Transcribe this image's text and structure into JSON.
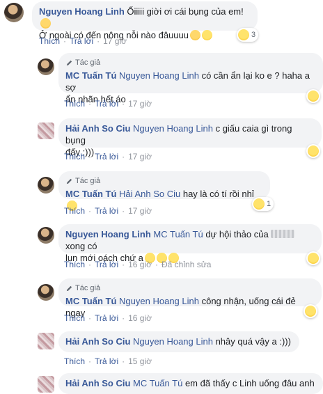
{
  "actions": {
    "like": "Thích",
    "reply": "Trả lời",
    "edited": "Đã chỉnh sửa"
  },
  "comments": [
    {
      "author": "Nguyen Hoang Linh",
      "line1": "Ốiiiii giời ơi cái bụng của em!",
      "line2": "Ở ngoài có đến nông nỗi nào đâuuuu",
      "time": "17 giờ",
      "reaction_count": "3"
    },
    {
      "badge": "Tác giả",
      "author": "MC Tuấn Tú",
      "tag": "Nguyen Hoang Linh",
      "line1": "có cần ẩn lại ko e ? haha a sợ",
      "line2": "ẩn nhãn hết áo",
      "time": "17 giờ"
    },
    {
      "author": "Hải Anh So Ciu",
      "tag": "Nguyen Hoang Linh",
      "line1": "c giấu caia gì trong bụng",
      "line2": "đấy :)))",
      "time": "17 giờ"
    },
    {
      "badge": "Tác giả",
      "author": "MC Tuấn Tú",
      "tag": "Hải Anh So Ciu",
      "line1": "hay là có tí rồi nhỉ",
      "time": "17 giờ",
      "reaction_count": "1"
    },
    {
      "author": "Nguyen Hoang Linh",
      "tag": "MC Tuấn Tú",
      "line1a": "dự hội thảo của",
      "line1b": "xong có",
      "line2": "lun mới oách chứ a",
      "time": "16 giờ"
    },
    {
      "badge": "Tác giả",
      "author": "MC Tuấn Tú",
      "tag": "Nguyen Hoang Linh",
      "line1": "công nhận, uống cái đẻ ngay",
      "time": "16 giờ"
    },
    {
      "author": "Hải Anh So Ciu",
      "tag": "Nguyen Hoang Linh",
      "line1": "nhây quá vậy a :)))",
      "time": "15 giờ"
    },
    {
      "author": "Hải Anh So Ciu",
      "tag": "MC Tuấn Tú",
      "line1": "em đã thấy c Linh uống đâu anh"
    }
  ]
}
